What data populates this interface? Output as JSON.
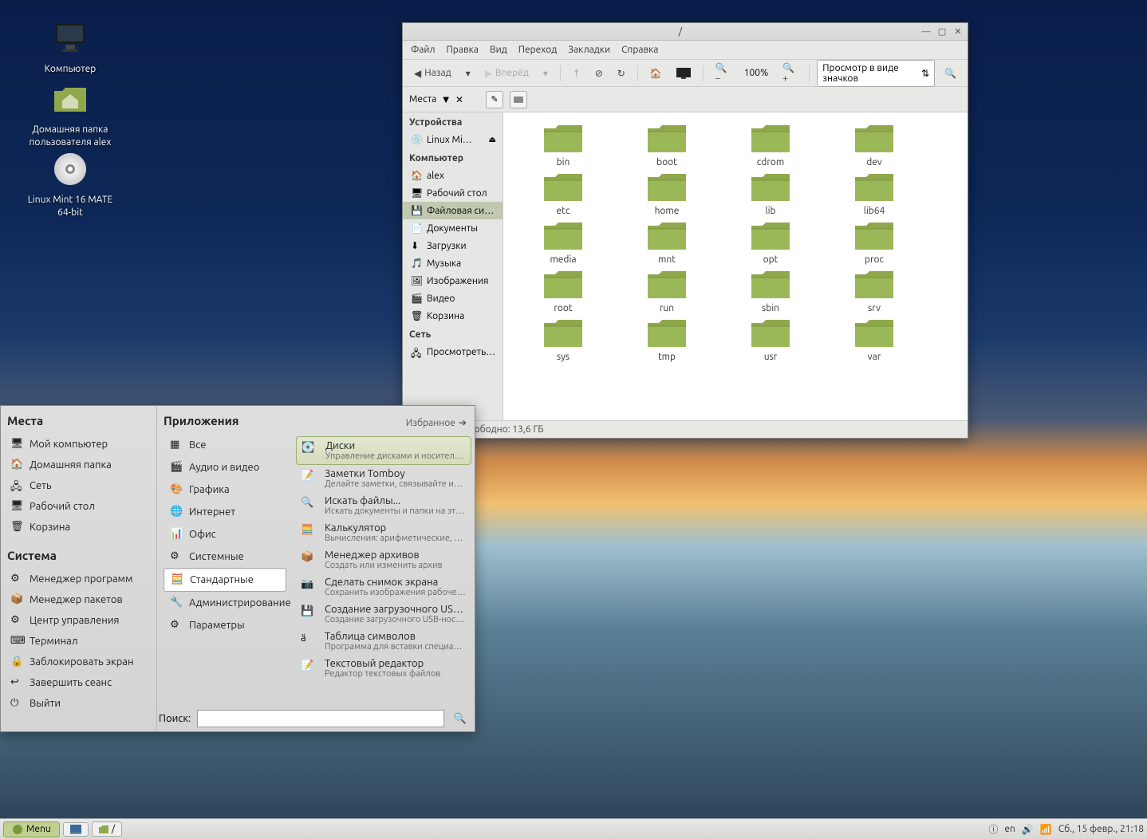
{
  "desktop": {
    "icons": [
      {
        "label": "Компьютер",
        "kind": "computer"
      },
      {
        "label": "Домашняя папка пользователя alex",
        "kind": "home"
      },
      {
        "label": "Linux Mint 16 MATE 64-bit",
        "kind": "disc"
      }
    ]
  },
  "fm": {
    "title": "/",
    "menus": [
      "Файл",
      "Правка",
      "Вид",
      "Переход",
      "Закладки",
      "Справка"
    ],
    "back": "Назад",
    "forward": "Вперёд",
    "zoom": "100%",
    "view_selector": "Просмотр в виде значков",
    "places_label": "Места",
    "sidebar": {
      "devices_head": "Устройства",
      "devices": [
        {
          "label": "Linux Mi…",
          "eject": true
        }
      ],
      "computer_head": "Компьютер",
      "computer": [
        {
          "label": "alex",
          "icon": "home"
        },
        {
          "label": "Рабочий стол",
          "icon": "desktop"
        },
        {
          "label": "Файловая си…",
          "icon": "drive",
          "selected": true
        },
        {
          "label": "Документы",
          "icon": "docs"
        },
        {
          "label": "Загрузки",
          "icon": "downloads"
        },
        {
          "label": "Музыка",
          "icon": "music"
        },
        {
          "label": "Изображения",
          "icon": "pictures"
        },
        {
          "label": "Видео",
          "icon": "video"
        },
        {
          "label": "Корзина",
          "icon": "trash"
        }
      ],
      "network_head": "Сеть",
      "network": [
        {
          "label": "Просмотреть…",
          "icon": "network"
        }
      ]
    },
    "folders": [
      "bin",
      "boot",
      "cdrom",
      "dev",
      "etc",
      "home",
      "lib",
      "lib64",
      "media",
      "mnt",
      "opt",
      "proc",
      "root",
      "run",
      "sbin",
      "srv",
      "sys",
      "tmp",
      "usr",
      "var"
    ],
    "status": "23 объекта, свободно: 13,6 ГБ"
  },
  "menu": {
    "places_head": "Места",
    "places": [
      "Мой компьютер",
      "Домашняя папка",
      "Сеть",
      "Рабочий стол",
      "Корзина"
    ],
    "system_head": "Система",
    "system": [
      "Менеджер программ",
      "Менеджер пакетов",
      "Центр управления",
      "Терминал",
      "Заблокировать экран",
      "Завершить сеанс",
      "Выйти"
    ],
    "apps_head": "Приложения",
    "favorites": "Избранное",
    "categories": [
      {
        "label": "Все"
      },
      {
        "label": "Аудио и видео"
      },
      {
        "label": "Графика"
      },
      {
        "label": "Интернет"
      },
      {
        "label": "Офис"
      },
      {
        "label": "Системные"
      },
      {
        "label": "Стандартные",
        "selected": true
      },
      {
        "label": "Администрирование"
      },
      {
        "label": "Параметры"
      }
    ],
    "apps": [
      {
        "title": "Диски",
        "desc": "Управление дисками и носителями",
        "selected": true
      },
      {
        "title": "Заметки Tomboy",
        "desc": "Делайте заметки, связывайте их и…"
      },
      {
        "title": "Искать файлы...",
        "desc": "Искать документы и папки на это…"
      },
      {
        "title": "Калькулятор",
        "desc": "Вычисления: арифметические, на…"
      },
      {
        "title": "Менеджер архивов",
        "desc": "Создать или изменить архив"
      },
      {
        "title": "Сделать снимок экрана",
        "desc": "Сохранить изображения рабочего…"
      },
      {
        "title": "Создание загрузочного USB-…",
        "desc": "Создание загрузочного USB-носит…"
      },
      {
        "title": "Таблица символов",
        "desc": "Программа для вставки специаль…"
      },
      {
        "title": "Текстовый редактор",
        "desc": "Редактор текстовых файлов"
      }
    ],
    "search_label": "Поиск:",
    "search_value": ""
  },
  "taskbar": {
    "menu_label": "Menu",
    "task_label": "/",
    "lang": "en",
    "date": "Сб., 15 февр., 21:18"
  }
}
